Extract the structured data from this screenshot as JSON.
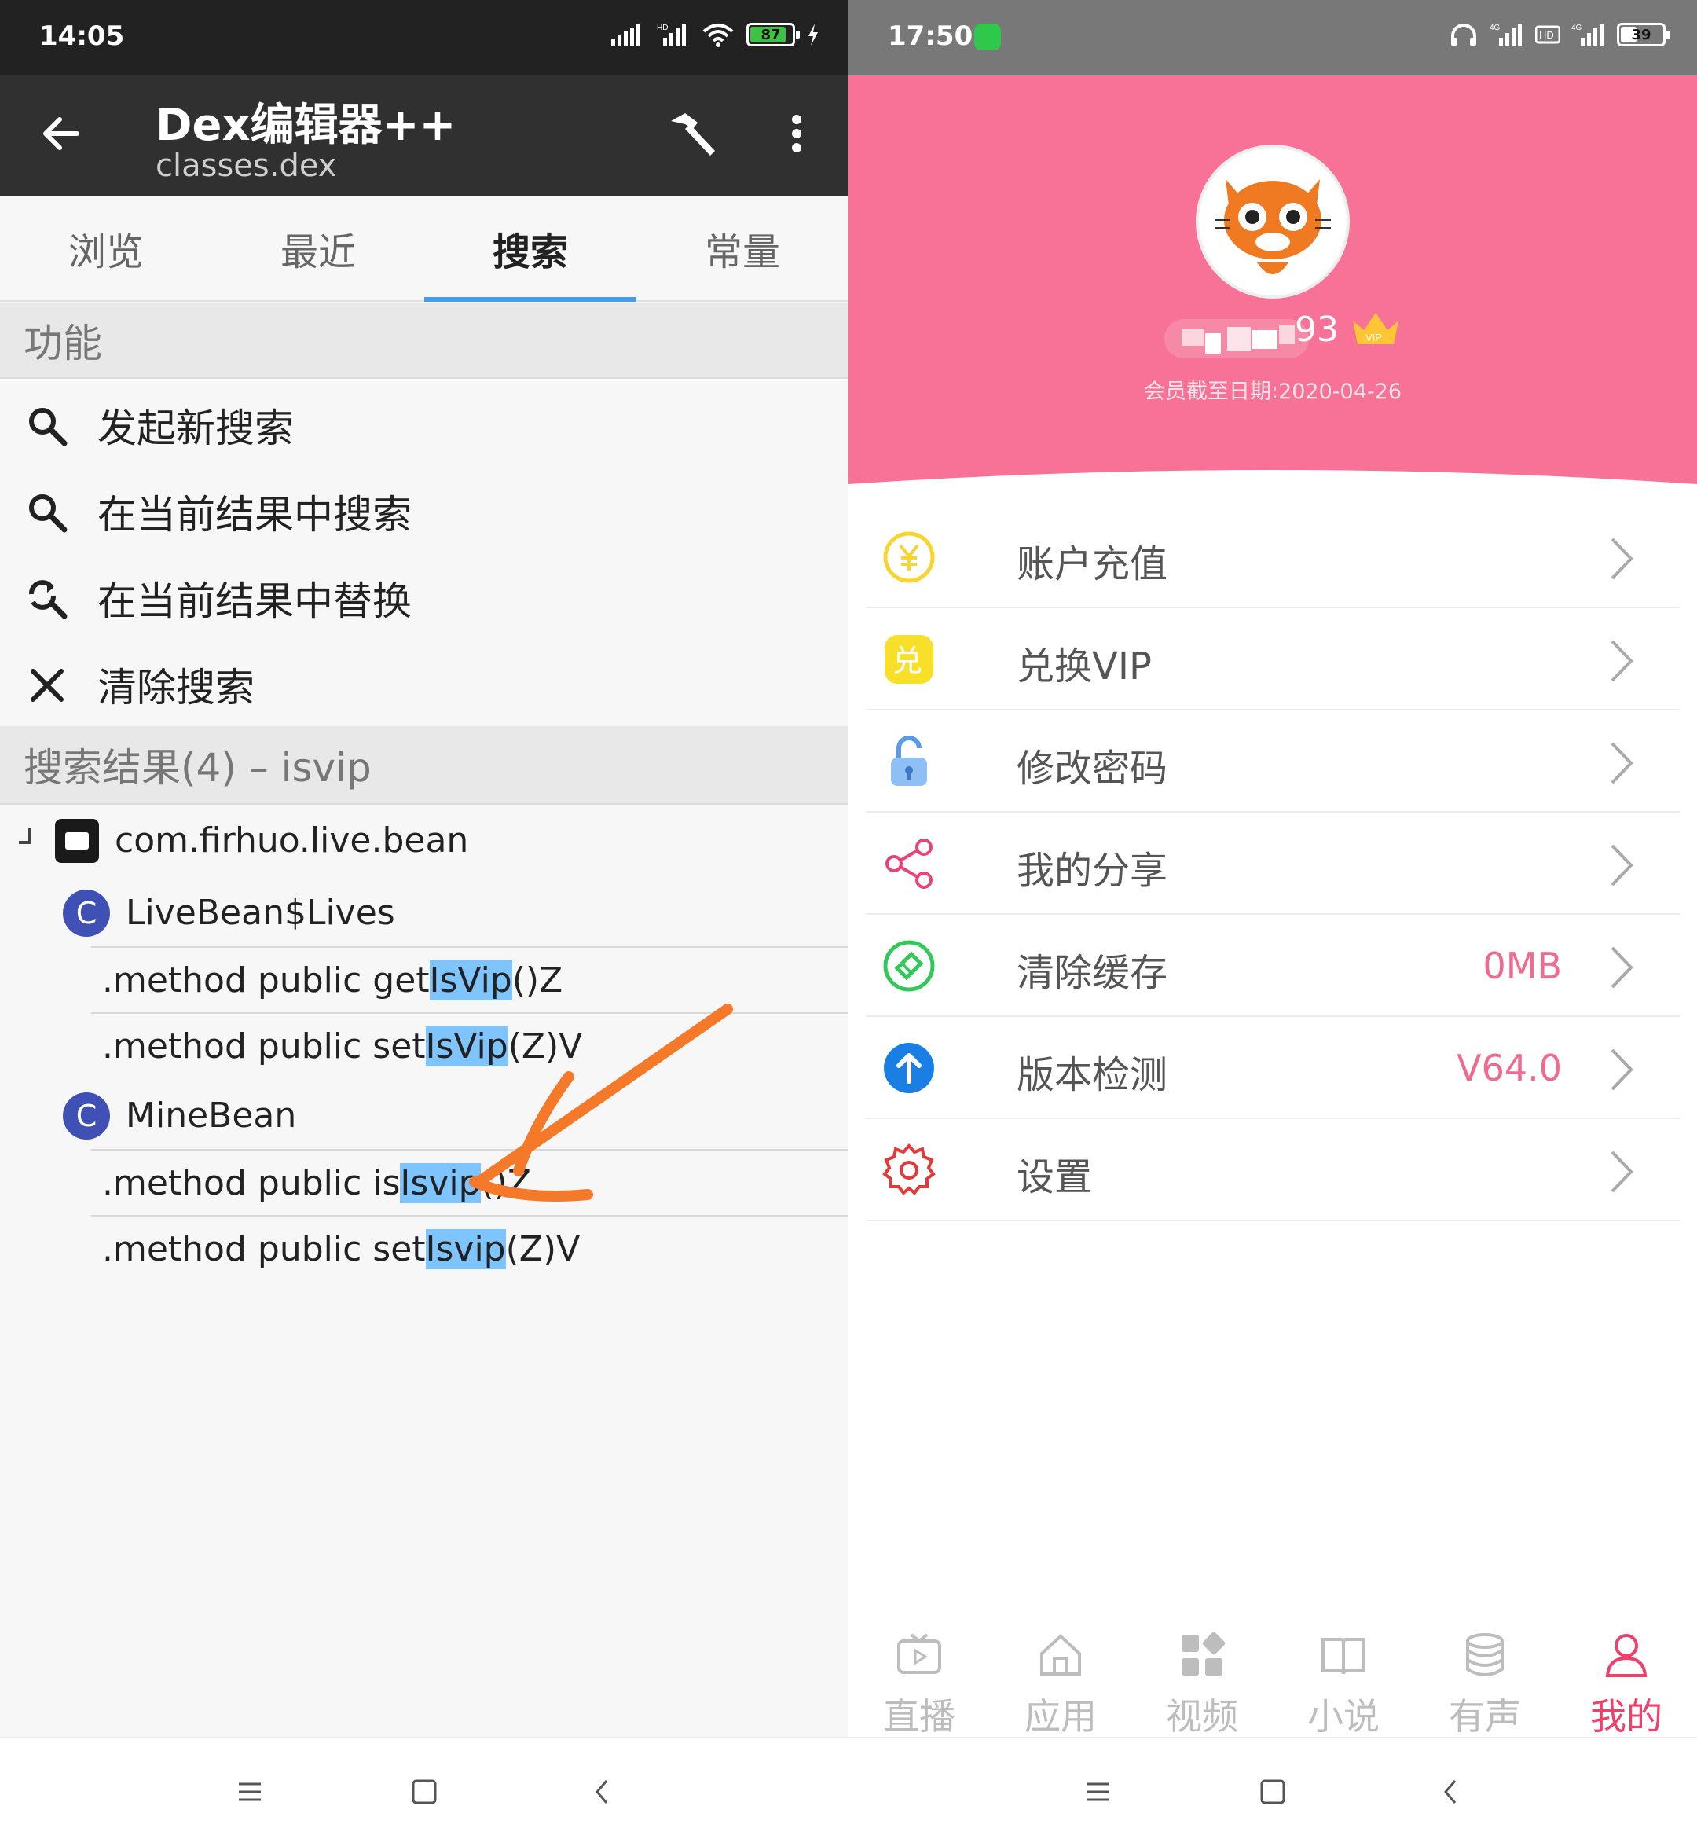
{
  "left_app": {
    "status_bar": {
      "time": "14:05",
      "battery": "87",
      "battery_level": 0.87
    },
    "toolbar": {
      "title": "Dex编辑器++",
      "subtitle": "classes.dex",
      "back_icon": "arrow-back-icon",
      "build_icon": "hammer-icon",
      "more_icon": "more-vert-icon"
    },
    "tabs": [
      "浏览",
      "最近",
      "搜索",
      "常量"
    ],
    "active_tab": "搜索",
    "functions_header": "功能",
    "functions": [
      {
        "label": "发起新搜索",
        "icon": "search-icon"
      },
      {
        "label": "在当前结果中搜索",
        "icon": "search-icon"
      },
      {
        "label": "在当前结果中替换",
        "icon": "search-replace-icon"
      },
      {
        "label": "清除搜索",
        "icon": "close-icon"
      }
    ],
    "results_header": "搜索结果(4) – isvip",
    "package": "com.firhuo.live.bean",
    "classes": [
      {
        "badge": "C",
        "name": "LiveBean$Lives",
        "methods": [
          {
            "prefix": ".method public get",
            "match": "IsVip",
            "suffix": "()Z"
          },
          {
            "prefix": ".method public set",
            "match": "IsVip",
            "suffix": "(Z)V"
          }
        ]
      },
      {
        "badge": "C",
        "name": "MineBean",
        "methods": [
          {
            "prefix": ".method public is",
            "match": "Isvip",
            "suffix": "()Z"
          },
          {
            "prefix": ".method public set",
            "match": "Isvip",
            "suffix": "(Z)V"
          }
        ]
      }
    ],
    "colors": {
      "highlight": "#7ec4ff",
      "tab_indicator": "#4a9be6",
      "annotation_arrow": "#f47a2a",
      "class_badge": "#3f51b5"
    }
  },
  "right_app": {
    "status_bar": {
      "time": "17:50",
      "battery": "39",
      "battery_level": 0.39,
      "network": "4G"
    },
    "profile": {
      "username_suffix": "93",
      "vip_badge": "VIP",
      "membership": "会员截至日期:2020-04-26"
    },
    "menu": [
      {
        "label": "账户充值",
        "icon": "yuan-coin-icon",
        "value": ""
      },
      {
        "label": "兑换VIP",
        "icon": "redeem-icon",
        "value": ""
      },
      {
        "label": "修改密码",
        "icon": "lock-icon",
        "value": ""
      },
      {
        "label": "我的分享",
        "icon": "share-icon",
        "value": ""
      },
      {
        "label": "清除缓存",
        "icon": "clear-cache-icon",
        "value": "0MB"
      },
      {
        "label": "版本检测",
        "icon": "upload-arrow-icon",
        "value": "V64.0"
      },
      {
        "label": "设置",
        "icon": "gear-icon",
        "value": ""
      }
    ],
    "bottom_tabs": [
      {
        "label": "直播",
        "icon": "tv-icon"
      },
      {
        "label": "应用",
        "icon": "home-icon"
      },
      {
        "label": "视频",
        "icon": "grid-icon"
      },
      {
        "label": "小说",
        "icon": "book-icon"
      },
      {
        "label": "有声",
        "icon": "stack-icon"
      },
      {
        "label": "我的",
        "icon": "person-icon"
      }
    ],
    "active_bottom_tab": "我的",
    "colors": {
      "header": "#f87196",
      "accent": "#ef3f6b",
      "value": "#f06a8e"
    }
  }
}
